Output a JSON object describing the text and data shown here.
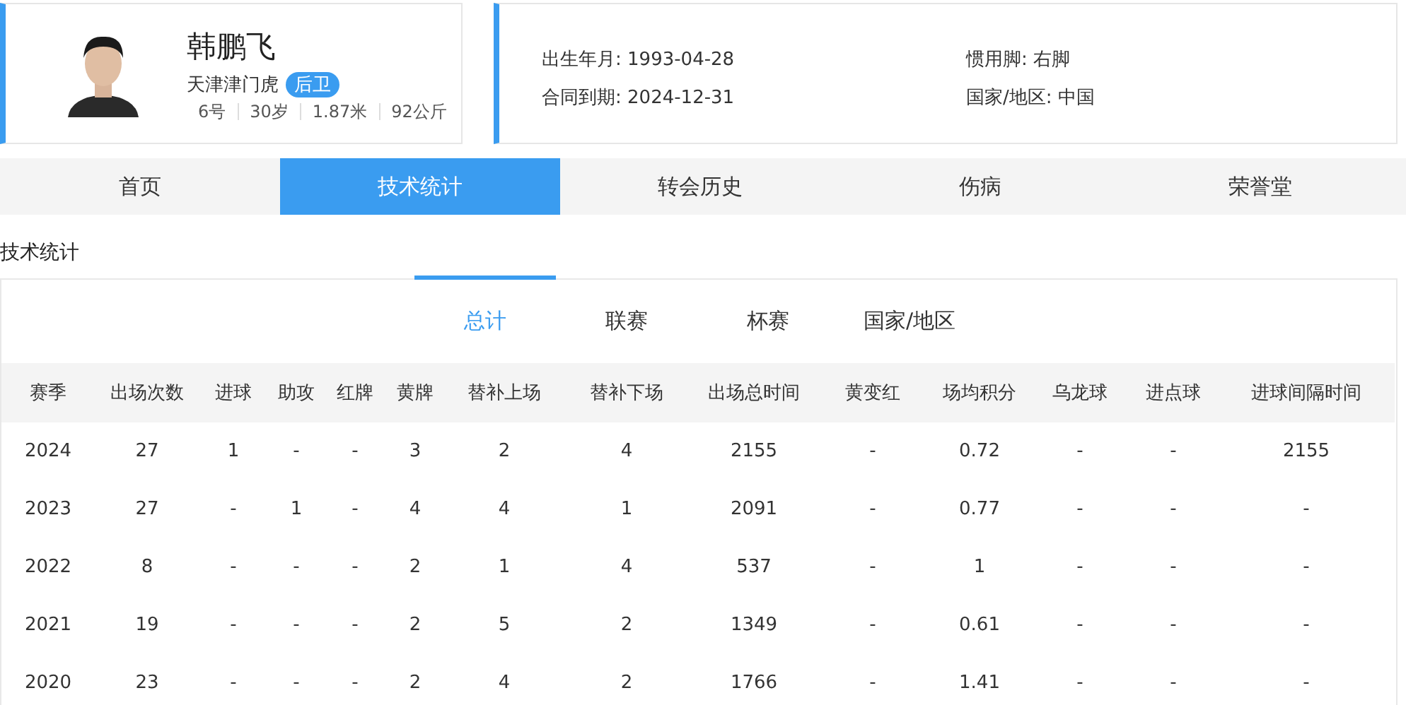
{
  "player": {
    "name": "韩鹏飞",
    "team": "天津津门虎",
    "position": "后卫",
    "facts": [
      "6号",
      "30岁",
      "1.87米",
      "92公斤"
    ],
    "photo": {
      "kind": "picture"
    }
  },
  "details": [
    {
      "label": "出生年月:",
      "value": "1993-04-28"
    },
    {
      "label": "惯用脚:",
      "value": "右脚"
    },
    {
      "label": "合同到期:",
      "value": "2024-12-31"
    },
    {
      "label": "国家/地区:",
      "value": "中国"
    }
  ],
  "nav_tabs": [
    {
      "label": "首页",
      "selected": false
    },
    {
      "label": "技术统计",
      "selected": true
    },
    {
      "label": "转会历史",
      "selected": false
    },
    {
      "label": "伤病",
      "selected": false
    },
    {
      "label": "荣誉堂",
      "selected": false
    }
  ],
  "section_title": "技术统计",
  "sub_tabs": [
    {
      "label": "总计",
      "selected": true
    },
    {
      "label": "联赛",
      "selected": false
    },
    {
      "label": "杯赛",
      "selected": false
    },
    {
      "label": "国家/地区",
      "selected": false
    }
  ],
  "table": {
    "columns": [
      "赛季",
      "出场次数",
      "进球",
      "助攻",
      "红牌",
      "黄牌",
      "替补上场",
      "替补下场",
      "出场总时间",
      "黄变红",
      "场均积分",
      "乌龙球",
      "进点球",
      "进球间隔时间"
    ],
    "rows": [
      [
        "2024",
        "27",
        "1",
        "-",
        "-",
        "3",
        "2",
        "4",
        "2155",
        "-",
        "0.72",
        "-",
        "-",
        "2155"
      ],
      [
        "2023",
        "27",
        "-",
        "1",
        "-",
        "4",
        "4",
        "1",
        "2091",
        "-",
        "0.77",
        "-",
        "-",
        "-"
      ],
      [
        "2022",
        "8",
        "-",
        "-",
        "-",
        "2",
        "1",
        "4",
        "537",
        "-",
        "1",
        "-",
        "-",
        "-"
      ],
      [
        "2021",
        "19",
        "-",
        "-",
        "-",
        "2",
        "5",
        "2",
        "1349",
        "-",
        "0.61",
        "-",
        "-",
        "-"
      ],
      [
        "2020",
        "23",
        "-",
        "-",
        "-",
        "2",
        "4",
        "2",
        "1766",
        "-",
        "1.41",
        "-",
        "-",
        "-"
      ]
    ]
  }
}
